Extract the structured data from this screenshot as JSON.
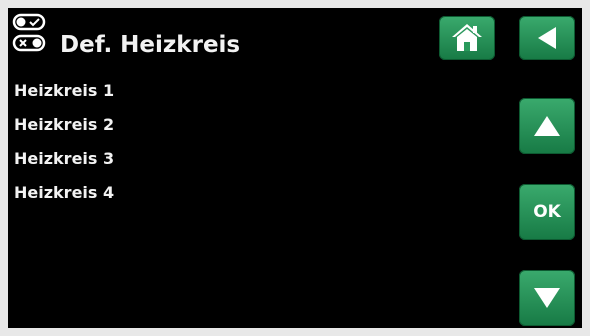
{
  "header": {
    "title": "Def. Heizkreis",
    "icon": "toggle-switches-icon"
  },
  "nav": {
    "home_icon": "home-icon",
    "back_icon": "back-arrow-icon",
    "up_icon": "arrow-up-icon",
    "ok_label": "OK",
    "down_icon": "arrow-down-icon"
  },
  "menu": {
    "items": [
      {
        "label": "Heizkreis 1"
      },
      {
        "label": "Heizkreis 2"
      },
      {
        "label": "Heizkreis 3"
      },
      {
        "label": "Heizkreis 4"
      }
    ]
  },
  "colors": {
    "background": "#000000",
    "button": "#2a9a5c",
    "text": "#f2f2f2"
  }
}
